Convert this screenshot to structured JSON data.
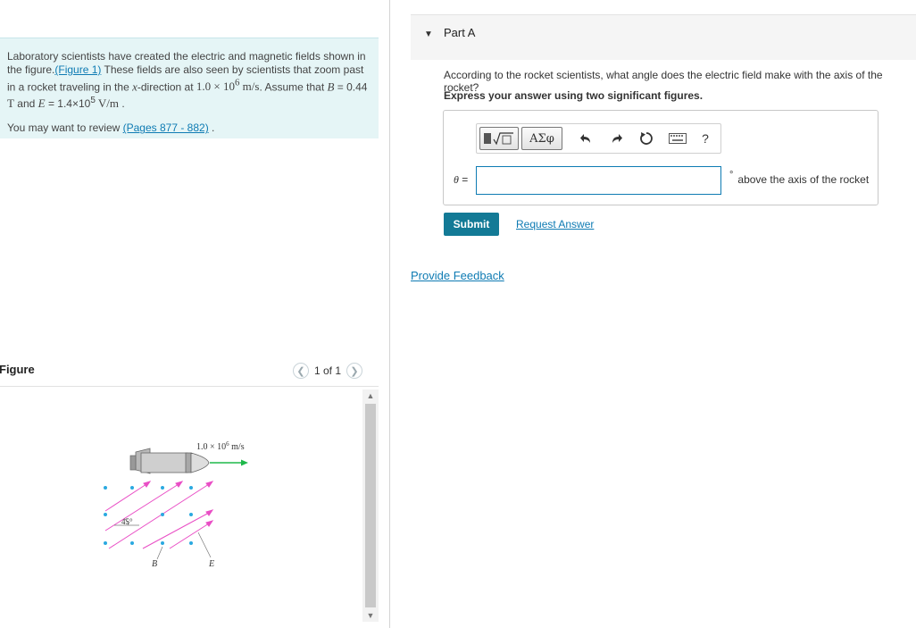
{
  "intro": {
    "line1": "Laboratory scientists have created the electric and magnetic fields shown in the figure.",
    "figure_link": "(Figure 1)",
    "line2": " These fields are also seen by scientists that zoom past in a rocket traveling in the ",
    "x_symbol": "x",
    "line3": "-direction at ",
    "speed": "1.0 × 10",
    "speed_exp": "6",
    "speed_unit": " m/s",
    "line4": ". Assume that ",
    "b_symbol": "B",
    "b_value": " = 0.44",
    "b_unit": "T",
    "and_text": " and ",
    "e_symbol": "E",
    "e_value": " = 1.4×10",
    "e_exp": "5",
    "e_unit": " V/m",
    "end": " .",
    "review_prefix": "You may want to review ",
    "review_link": "(Pages 877 - 882)",
    "review_suffix": " ."
  },
  "figure": {
    "title": "Figure",
    "pager_text": "1 of 1",
    "prev_icon": "chevron-left-icon",
    "next_icon": "chevron-right-icon",
    "velocity_label": "1.0 × 10",
    "velocity_exp": "6",
    "velocity_unit": " m/s",
    "angle_label": "45°",
    "b_label": "B",
    "e_label": "E",
    "colors": {
      "field_lines": "#e94ec5",
      "dots": "#2aa9e0",
      "velocity_arrow": "#1eb84a"
    }
  },
  "part": {
    "title": "Part A",
    "question": "According to the rocket scientists, what angle does the electric field make with the axis of the rocket?",
    "instruction": "Express your answer using two significant figures.",
    "toolbar": {
      "template_icon": "template-sqrt-icon",
      "greek_label": "ΑΣφ",
      "undo_icon": "undo-icon",
      "redo_icon": "redo-icon",
      "reset_icon": "reset-icon",
      "keyboard_icon": "keyboard-icon",
      "help_label": "?"
    },
    "variable_label": "θ",
    "equals": " =",
    "answer_value": "",
    "unit_symbol": "°",
    "unit_text": "above the axis of the rocket",
    "submit_label": "Submit",
    "request_label": "Request Answer",
    "feedback_label": "Provide Feedback",
    "accent": "#137a96"
  }
}
